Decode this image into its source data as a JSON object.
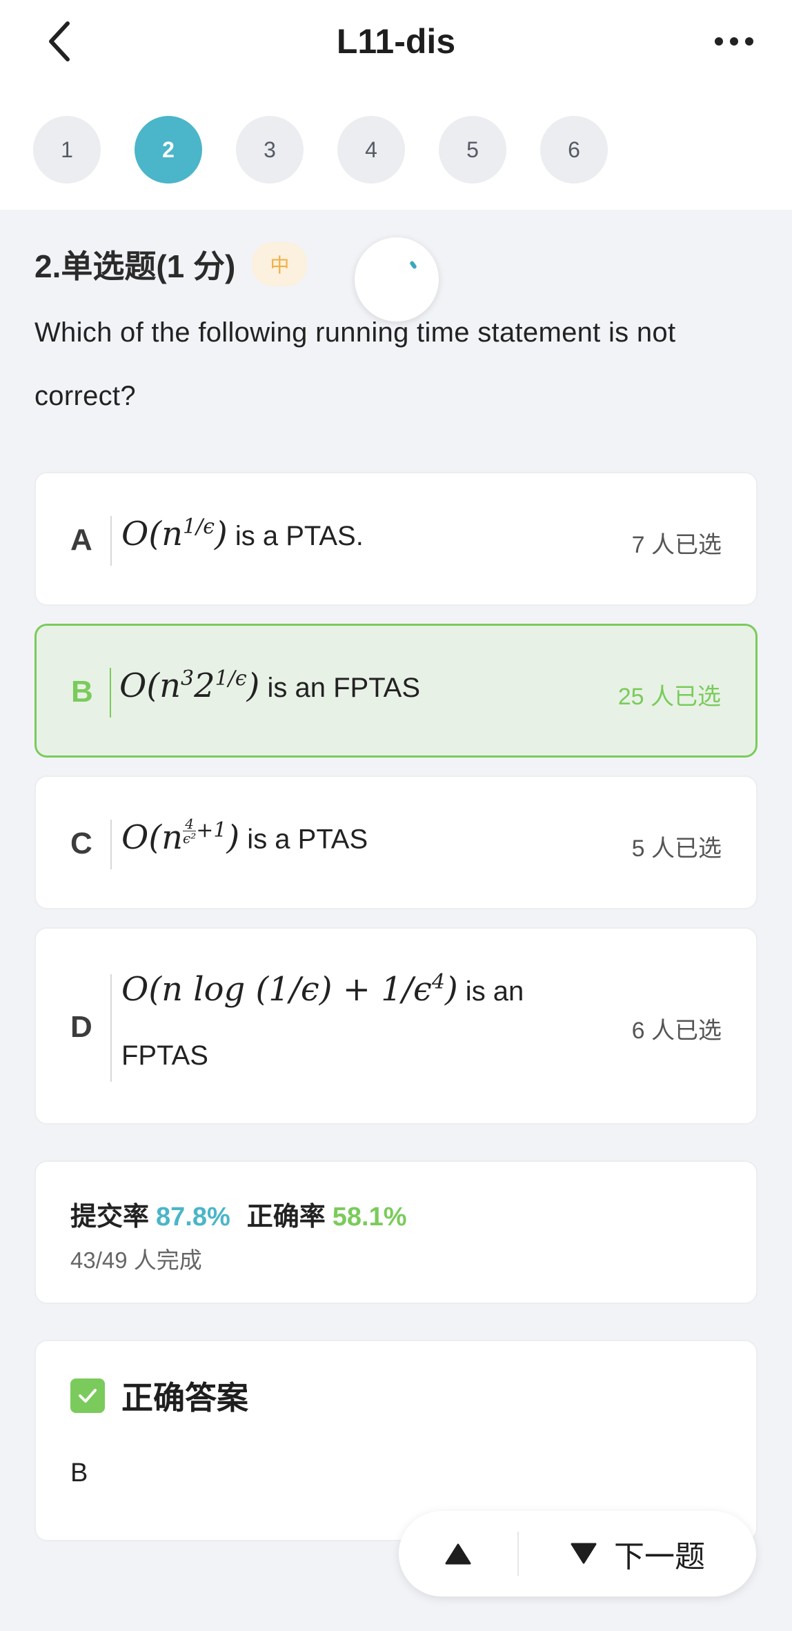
{
  "header": {
    "title": "L11-dis",
    "question_tabs": [
      "1",
      "2",
      "3",
      "4",
      "5",
      "6"
    ],
    "active_tab": "2"
  },
  "question": {
    "type_label": "2.单选题(1 分)",
    "difficulty": "中",
    "text": "Which of the following running time statement is not correct?"
  },
  "options": [
    {
      "letter": "A",
      "math": "O(n^(1/ε))",
      "suffix": " is a PTAS.",
      "count": "7 人已选",
      "correct": false
    },
    {
      "letter": "B",
      "math": "O(n^3 2^(1/ε))",
      "suffix": " is an FPTAS",
      "count": "25 人已选",
      "correct": true
    },
    {
      "letter": "C",
      "math": "O(n^(4/ε²+1))",
      "suffix": " is a PTAS",
      "count": "5 人已选",
      "correct": false
    },
    {
      "letter": "D",
      "math": "O(n log (1/ε) + 1/ε⁴)",
      "suffix": " is an",
      "suffix2": "FPTAS",
      "count": "6 人已选",
      "correct": false
    }
  ],
  "stats": {
    "submit_label": "提交率",
    "submit_value": "87.8%",
    "correct_label": "正确率",
    "correct_value": "58.1%",
    "completed": "43/49 人完成"
  },
  "answer": {
    "title": "正确答案",
    "value": "B"
  },
  "footer": {
    "next_label": "下一题"
  },
  "colors": {
    "accent": "#4BB5C9",
    "correct": "#7ACB5B",
    "difficulty_bg": "#FCF0DE",
    "difficulty_text": "#F0B044"
  }
}
